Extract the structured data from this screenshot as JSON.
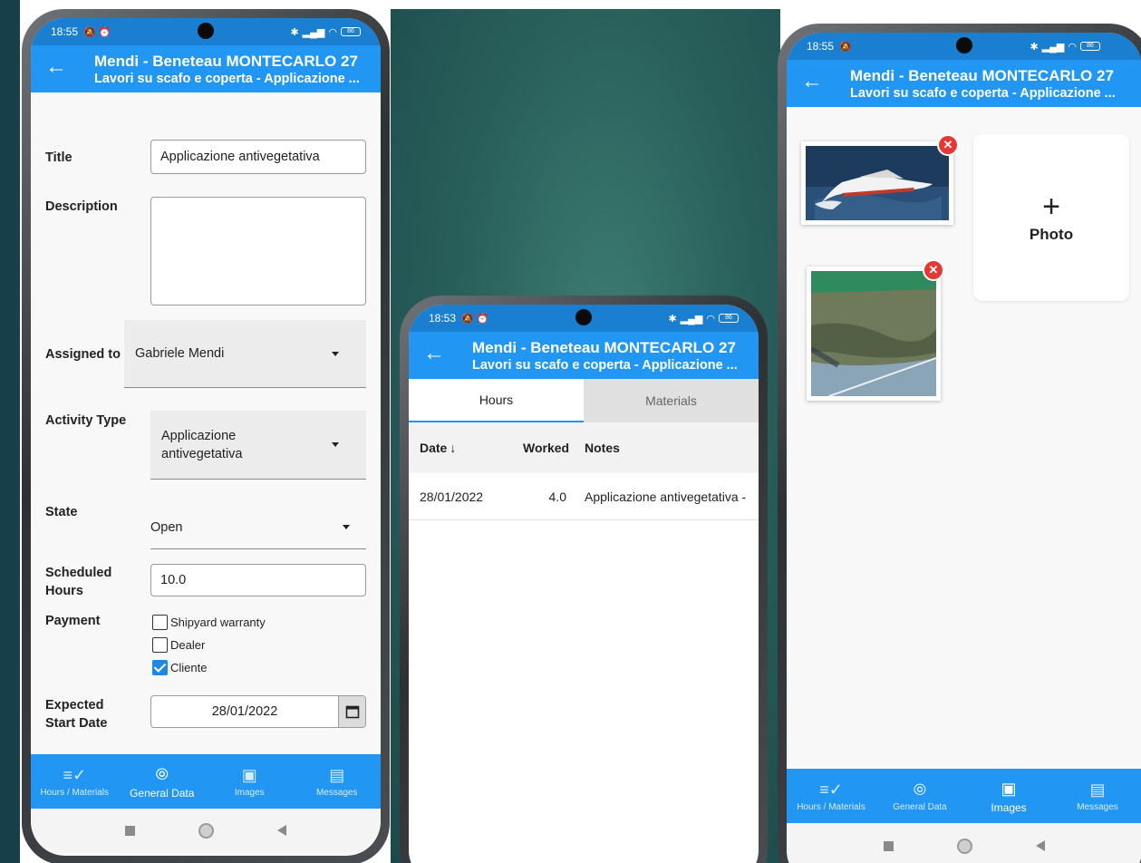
{
  "status_bar": {
    "left_time": "18:55",
    "middle_time": "18:53",
    "right_time": "18:55",
    "battery": "86"
  },
  "appbar": {
    "title": "Mendi - Beneteau MONTECARLO 27",
    "subtitle": "Lavori su scafo e coperta - Applicazione ..."
  },
  "form": {
    "title_label": "Title",
    "title_value": "Applicazione antivegetativa",
    "description_label": "Description",
    "description_value": "",
    "assigned_label": "Assigned to",
    "assigned_value": "Gabriele Mendi",
    "activity_label": "Activity Type",
    "activity_value_line1": "Applicazione",
    "activity_value_line2": "antivegetativa",
    "state_label": "State",
    "state_value": "Open",
    "scheduled_label_line1": "Scheduled",
    "scheduled_label_line2": "Hours",
    "scheduled_value": "10.0",
    "payment_label": "Payment",
    "payment_options": [
      {
        "label": "Shipyard warranty",
        "checked": false
      },
      {
        "label": "Dealer",
        "checked": false
      },
      {
        "label": "Cliente",
        "checked": true
      }
    ],
    "start_label_line1": "Expected",
    "start_label_line2": "Start Date",
    "start_value": "28/01/2022"
  },
  "bottom_nav": {
    "hours_materials": "Hours / Materials",
    "general_data": "General Data",
    "images": "Images",
    "messages": "Messages"
  },
  "hours": {
    "tab_hours": "Hours",
    "tab_materials": "Materials",
    "col_date": "Date",
    "col_worked": "Worked",
    "col_notes": "Notes",
    "rows": [
      {
        "date": "28/01/2022",
        "worked": "4.0",
        "notes": "Applicazione antivegetativa -"
      }
    ]
  },
  "images": {
    "add_label": "Photo"
  },
  "colors": {
    "primary": "#2196f3",
    "status_bar": "#1a7fd1",
    "delete_badge": "#e53935",
    "checked": "#1e88e5"
  }
}
